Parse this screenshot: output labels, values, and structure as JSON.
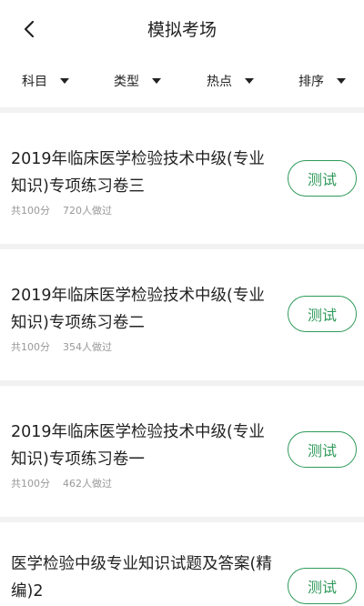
{
  "header": {
    "title": "模拟考场"
  },
  "filters": [
    {
      "label": "科目"
    },
    {
      "label": "类型"
    },
    {
      "label": "热点"
    },
    {
      "label": "排序"
    }
  ],
  "papers": [
    {
      "title": "2019年临床医学检验技术中级(专业知识)专项练习卷三",
      "score": "共100分",
      "count": "720人做过",
      "button": "测试"
    },
    {
      "title": "2019年临床医学检验技术中级(专业知识)专项练习卷二",
      "score": "共100分",
      "count": "354人做过",
      "button": "测试"
    },
    {
      "title": "2019年临床医学检验技术中级(专业知识)专项练习卷一",
      "score": "共100分",
      "count": "462人做过",
      "button": "测试"
    },
    {
      "title": "医学检验中级专业知识试题及答案(精编)2",
      "button": "测试"
    }
  ]
}
